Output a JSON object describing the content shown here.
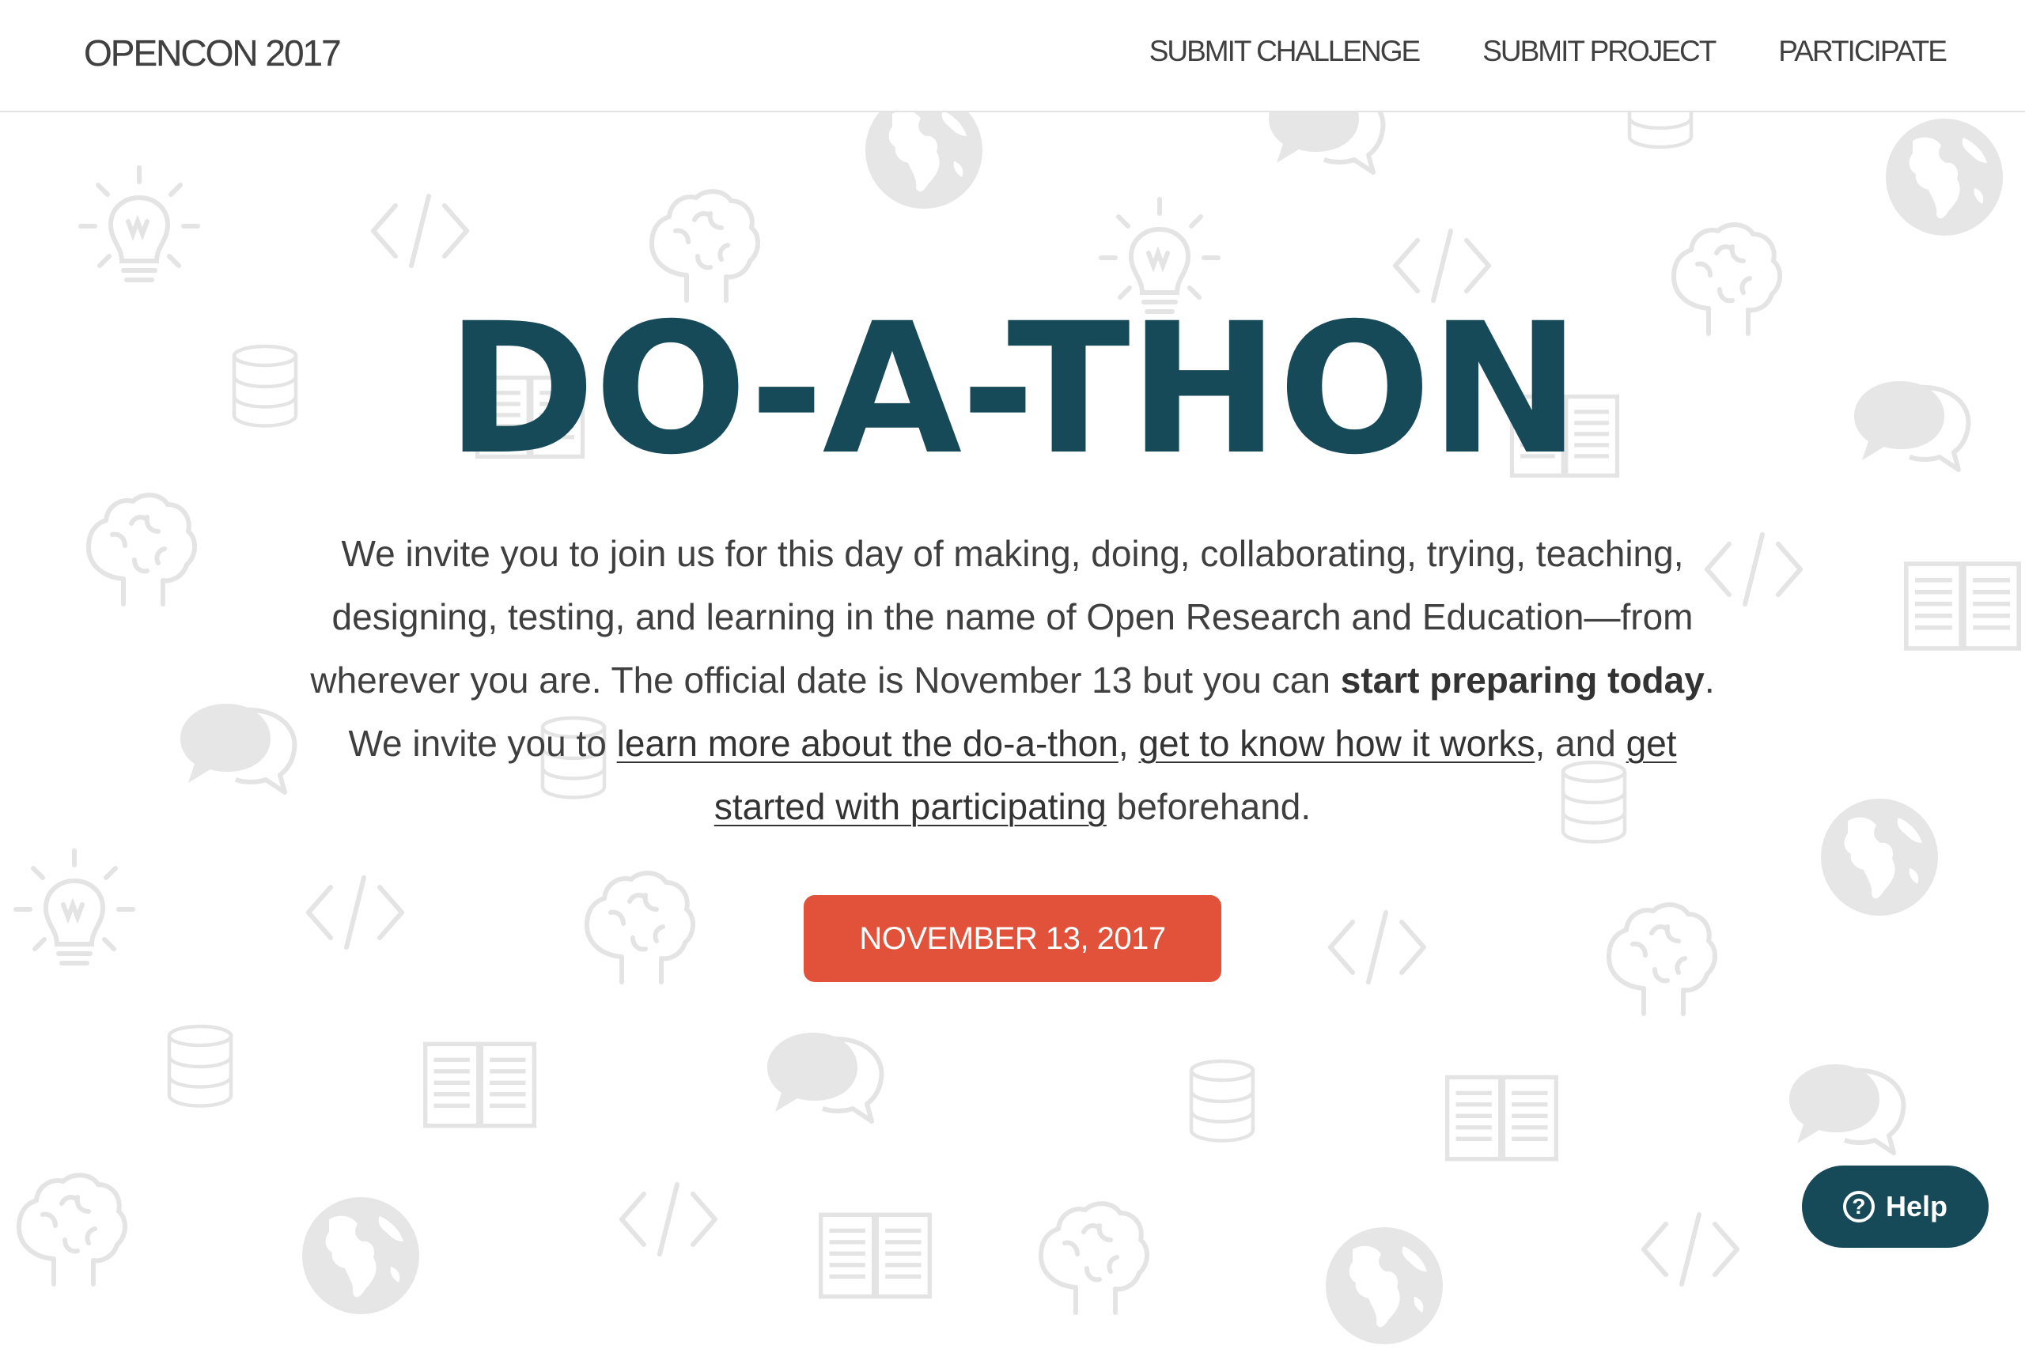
{
  "header": {
    "brand": "OPENCON 2017",
    "nav": [
      {
        "label": "SUBMIT CHALLENGE"
      },
      {
        "label": "SUBMIT PROJECT"
      },
      {
        "label": "PARTICIPATE"
      }
    ]
  },
  "hero": {
    "title": "DO-A-THON",
    "para_intro": "We invite you to join us for this day of making, doing, collaborating, trying, teaching, designing, testing, and learning in the name of Open Research and Education—from wherever you are. The official date is November 13 but you can ",
    "bold_link": "start preparing today",
    "para_mid": ". We invite you to ",
    "link_learn": "learn more about the do-a-thon",
    "sep_1": ", ",
    "link_how": "get to know how it works",
    "sep_2": ", and ",
    "link_started": "get started with participating",
    "para_end": " beforehand.",
    "cta_label": "NOVEMBER 13, 2017"
  },
  "help_widget": {
    "icon_glyph": "?",
    "label": "Help"
  },
  "colors": {
    "title": "#174a59",
    "cta": "#e2513a",
    "help": "#174a59",
    "pattern_icons": "#e6e6e6"
  },
  "background_icons": [
    "lightbulb-icon",
    "code-icon",
    "brain-icon",
    "globe-icon",
    "database-icon",
    "book-icon",
    "speech-bubbles-icon"
  ]
}
